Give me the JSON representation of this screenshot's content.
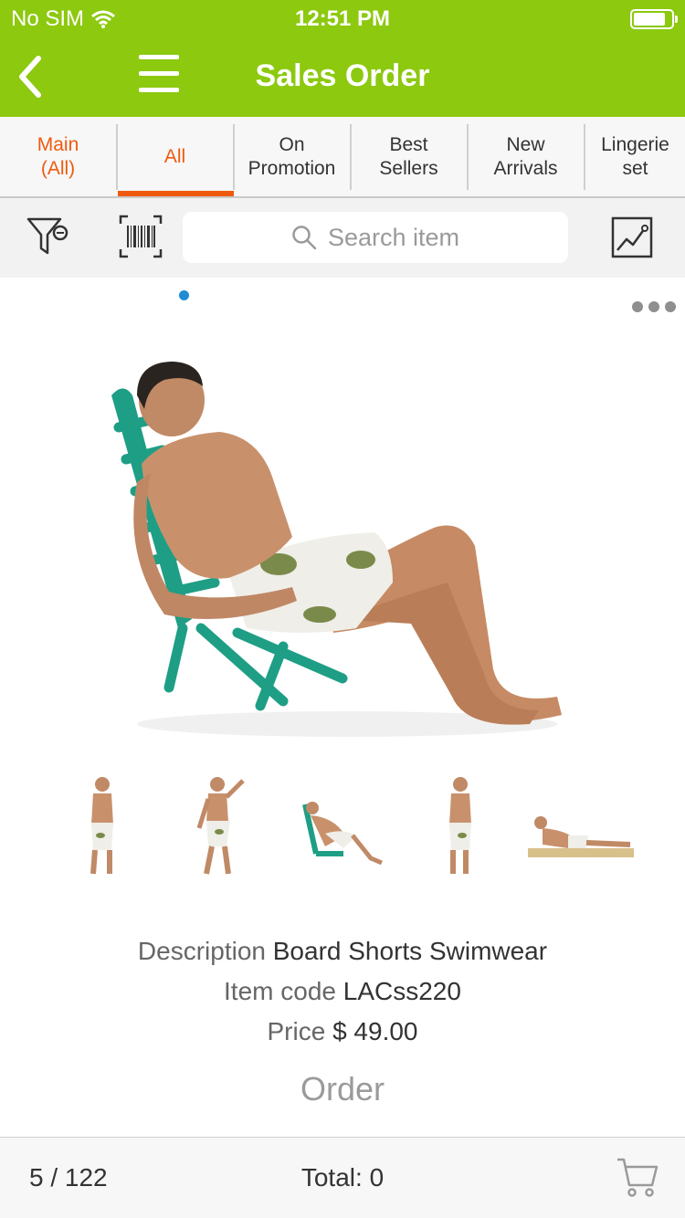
{
  "status": {
    "carrier": "No SIM",
    "time": "12:51 PM",
    "icons": [
      "wifi-icon",
      "battery-icon"
    ]
  },
  "nav": {
    "title": "Sales Order",
    "icons": [
      "back-arrow-icon",
      "hamburger-menu-icon"
    ]
  },
  "tabs": [
    {
      "label": "Main\n(All)"
    },
    {
      "label": "All",
      "selected": true
    },
    {
      "label": "On\nPromotion"
    },
    {
      "label": "Best\nSellers"
    },
    {
      "label": "New\nArrivals"
    },
    {
      "label": "Lingerie\nset"
    }
  ],
  "toolbar": {
    "search_placeholder": "Search item",
    "icons": [
      "filter-icon",
      "barcode-scan-icon",
      "search-icon",
      "image-chart-icon"
    ]
  },
  "product": {
    "description_label": "Description",
    "description": "Board Shorts Swimwear",
    "item_code_label": "Item code",
    "item_code": "LACss220",
    "price_label": "Price",
    "price": "$  49.00",
    "order_label": "Order"
  },
  "footer": {
    "page": "5 / 122",
    "total": "Total: 0",
    "icons": [
      "cart-icon"
    ]
  },
  "colors": {
    "brand_green": "#8cc90f",
    "accent_orange": "#ef5a0f",
    "indicator_blue": "#1f8bd3"
  }
}
